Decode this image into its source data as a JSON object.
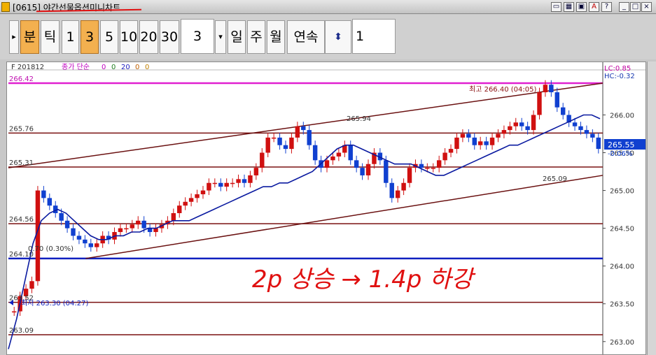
{
  "window": {
    "title": "[0615]  야간선물옵션미니차트",
    "buttons": [
      "▭",
      "▦",
      "▣",
      "A",
      "?",
      "_",
      "□",
      "×"
    ]
  },
  "toolbar": {
    "arrow": "▸",
    "period_buttons": [
      {
        "label": "분",
        "active": true
      },
      {
        "label": "틱",
        "active": false
      },
      {
        "label": "1",
        "active": false
      },
      {
        "label": "3",
        "active": true
      },
      {
        "label": "5",
        "active": false
      },
      {
        "label": "10",
        "active": false
      },
      {
        "label": "20",
        "active": false
      },
      {
        "label": "30",
        "active": false
      }
    ],
    "interval_value": "3",
    "dropdown_arrow": "▾",
    "day_buttons": [
      "일",
      "주",
      "월",
      "연속"
    ],
    "updown_icon": "⬍",
    "count_value": "1"
  },
  "legend": {
    "symbol": "F 201812",
    "indicator": "종가 단순",
    "values": [
      "0",
      "0",
      "20",
      "0",
      "0"
    ]
  },
  "stats": {
    "lc": "LC:0.85",
    "hc": "HC:-0.32"
  },
  "annotations": {
    "high": "최고 266.40 (04:05)",
    "low": "최저 263.30 (04:27)",
    "mid_high": "265.94",
    "mid_low": "265.09",
    "pct": "0.70 (0.30%)",
    "handwriting": "2p 상승 → 1.4p 하강"
  },
  "current": {
    "price": "265.55",
    "change": "-0.06%"
  },
  "chart_data": {
    "type": "candlestick",
    "y_axis": {
      "ticks": [
        "266.00",
        "265.50",
        "265.00",
        "264.50",
        "264.00",
        "263.50",
        "263.00"
      ],
      "ylim": [
        262.85,
        266.55
      ]
    },
    "horizontal_lines": [
      {
        "label": "266.42",
        "value": 266.42,
        "color": "#e020d0"
      },
      {
        "label": "265.76",
        "value": 265.76,
        "color": "#7a1010"
      },
      {
        "label": "265.31",
        "value": 265.31,
        "color": "#7a1010"
      },
      {
        "label": "264.56",
        "value": 264.56,
        "color": "#7a1010"
      },
      {
        "label": "264.10",
        "value": 264.1,
        "color": "#1020c0"
      },
      {
        "label": "263.52",
        "value": 263.52,
        "color": "#7a1010"
      },
      {
        "label": "263.09",
        "value": 263.09,
        "color": "#7a1010"
      }
    ],
    "trendlines": [
      {
        "from": [
          0,
          265.3
        ],
        "to": [
          1,
          266.42
        ]
      },
      {
        "from": [
          0.13,
          264.1
        ],
        "to": [
          1,
          265.2
        ]
      }
    ],
    "close_series": [
      263.4,
      263.6,
      263.7,
      263.8,
      265.0,
      264.9,
      264.8,
      264.7,
      264.6,
      264.5,
      264.4,
      264.35,
      264.3,
      264.25,
      264.3,
      264.4,
      264.35,
      264.45,
      264.5,
      264.5,
      264.55,
      264.6,
      264.5,
      264.45,
      264.5,
      264.55,
      264.6,
      264.7,
      264.8,
      264.85,
      264.9,
      264.95,
      265.0,
      265.1,
      265.1,
      265.05,
      265.1,
      265.1,
      265.15,
      265.1,
      265.2,
      265.3,
      265.5,
      265.7,
      265.7,
      265.6,
      265.55,
      265.7,
      265.85,
      265.8,
      265.6,
      265.4,
      265.3,
      265.4,
      265.45,
      265.5,
      265.6,
      265.4,
      265.3,
      265.2,
      265.35,
      265.5,
      265.4,
      265.1,
      264.9,
      265.0,
      265.1,
      265.3,
      265.35,
      265.3,
      265.3,
      265.3,
      265.4,
      265.5,
      265.55,
      265.7,
      265.75,
      265.7,
      265.6,
      265.65,
      265.6,
      265.7,
      265.75,
      265.8,
      265.85,
      265.9,
      265.85,
      265.8,
      266.0,
      266.3,
      266.4,
      266.3,
      266.1,
      266.0,
      265.9,
      265.85,
      265.8,
      265.75,
      265.7,
      265.55
    ],
    "ma_series": [
      262.9,
      263.3,
      263.8,
      264.3,
      264.6,
      264.7,
      264.75,
      264.7,
      264.6,
      264.5,
      264.4,
      264.35,
      264.35,
      264.4,
      264.4,
      264.45,
      264.45,
      264.5,
      264.5,
      264.55,
      264.6,
      264.6,
      264.6,
      264.65,
      264.7,
      264.75,
      264.8,
      264.85,
      264.9,
      264.95,
      265.0,
      265.05,
      265.05,
      265.1,
      265.1,
      265.15,
      265.2,
      265.25,
      265.35,
      265.45,
      265.55,
      265.6,
      265.6,
      265.55,
      265.5,
      265.45,
      265.4,
      265.35,
      265.35,
      265.35,
      265.3,
      265.25,
      265.2,
      265.2,
      265.25,
      265.3,
      265.35,
      265.4,
      265.45,
      265.5,
      265.55,
      265.6,
      265.6,
      265.65,
      265.7,
      265.75,
      265.8,
      265.85,
      265.9,
      265.95,
      266.0,
      266.0,
      265.95
    ]
  }
}
